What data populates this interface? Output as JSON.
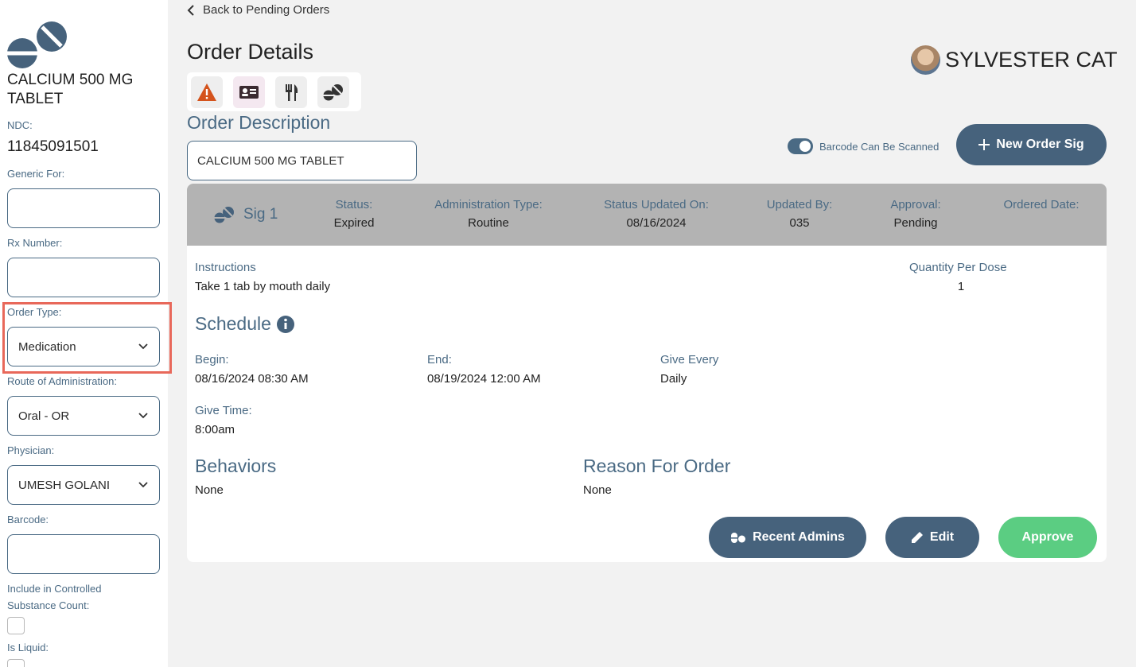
{
  "sidebar": {
    "drug_name": "CALCIUM 500 MG TABLET",
    "ndc_label": "NDC:",
    "ndc_value": "11845091501",
    "generic_for_label": "Generic For:",
    "generic_for_value": "",
    "rx_number_label": "Rx Number:",
    "rx_number_value": "",
    "order_type_label": "Order Type:",
    "order_type_value": "Medication",
    "route_label": "Route of Administration:",
    "route_value": "Oral - OR",
    "physician_label": "Physician:",
    "physician_value": "UMESH GOLANI",
    "barcode_label": "Barcode:",
    "barcode_value": "",
    "controlled_label_line1": "Include in Controlled",
    "controlled_label_line2": "Substance Count:",
    "controlled_checked": false,
    "liquid_label": "Is Liquid:",
    "liquid_checked": false
  },
  "header": {
    "back_label": "Back to Pending Orders",
    "title": "Order Details",
    "patient_name": "SYLVESTER CAT"
  },
  "icon_bar": {
    "icons": [
      "warning-icon",
      "id-card-icon",
      "utensils-icon",
      "pills-icon"
    ]
  },
  "order": {
    "description_heading": "Order Description",
    "description_value": "CALCIUM 500 MG TABLET",
    "barcode_toggle_label": "Barcode Can Be Scanned",
    "barcode_toggle_on": true,
    "new_sig_label": "New Order Sig"
  },
  "sig": {
    "label": "Sig 1",
    "status_label": "Status:",
    "status_value": "Expired",
    "admin_type_label": "Administration Type:",
    "admin_type_value": "Routine",
    "status_updated_label": "Status Updated On:",
    "status_updated_value": "08/16/2024",
    "updated_by_label": "Updated By:",
    "updated_by_value": "035",
    "approval_label": "Approval:",
    "approval_value": "Pending",
    "ordered_date_label": "Ordered Date:",
    "ordered_date_value": "",
    "instructions_label": "Instructions",
    "instructions_value": "Take 1 tab by mouth daily",
    "qty_label": "Quantity Per Dose",
    "qty_value": "1",
    "schedule_heading": "Schedule",
    "begin_label": "Begin:",
    "begin_value": "08/16/2024 08:30 AM",
    "end_label": "End:",
    "end_value": "08/19/2024 12:00 AM",
    "give_every_label": "Give Every",
    "give_every_value": "Daily",
    "give_time_label": "Give Time:",
    "give_time_value": "8:00am",
    "behaviors_heading": "Behaviors",
    "behaviors_value": "None",
    "reason_heading": "Reason For Order",
    "reason_value": "None",
    "recent_admins_label": "Recent Admins",
    "edit_label": "Edit",
    "approve_label": "Approve"
  },
  "colors": {
    "accent": "#4a6a84",
    "button_dark": "#46627c",
    "approve_green": "#5bcd82",
    "header_gray": "#b3b3b3",
    "highlight_red": "#e8685a",
    "warning_orange": "#d4531c"
  }
}
